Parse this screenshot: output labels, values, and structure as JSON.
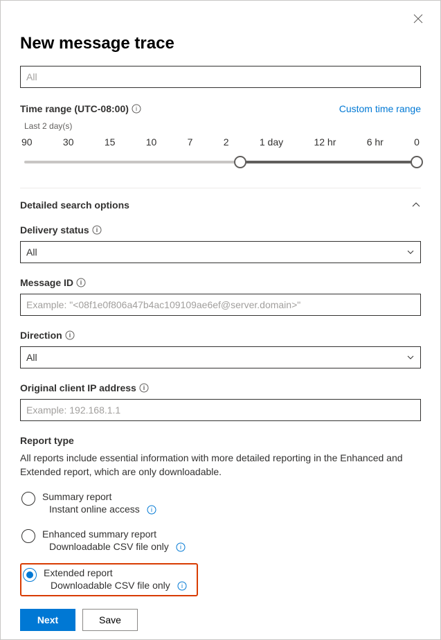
{
  "header": {
    "title": "New message trace"
  },
  "top_input": {
    "placeholder": "All",
    "value": ""
  },
  "time_range": {
    "label": "Time range (UTC-08:00)",
    "custom_link": "Custom time range",
    "current_value": "Last 2 day(s)",
    "ticks": [
      "90",
      "30",
      "15",
      "10",
      "7",
      "2",
      "1 day",
      "12 hr",
      "6 hr",
      "0"
    ]
  },
  "detailed": {
    "header": "Detailed search options"
  },
  "delivery_status": {
    "label": "Delivery status",
    "value": "All"
  },
  "message_id": {
    "label": "Message ID",
    "placeholder": "Example: \"<08f1e0f806a47b4ac109109ae6ef@server.domain>\"",
    "value": ""
  },
  "direction": {
    "label": "Direction",
    "value": "All"
  },
  "client_ip": {
    "label": "Original client IP address",
    "placeholder": "Example: 192.168.1.1",
    "value": ""
  },
  "report": {
    "label": "Report type",
    "description": "All reports include essential information with more detailed reporting in the Enhanced and Extended report, which are only downloadable.",
    "options": [
      {
        "title": "Summary report",
        "sub": "Instant online access",
        "selected": false,
        "highlight": false
      },
      {
        "title": "Enhanced summary report",
        "sub": "Downloadable CSV file only",
        "selected": false,
        "highlight": false
      },
      {
        "title": "Extended report",
        "sub": "Downloadable CSV file only",
        "selected": true,
        "highlight": true
      }
    ]
  },
  "buttons": {
    "next": "Next",
    "save": "Save"
  }
}
